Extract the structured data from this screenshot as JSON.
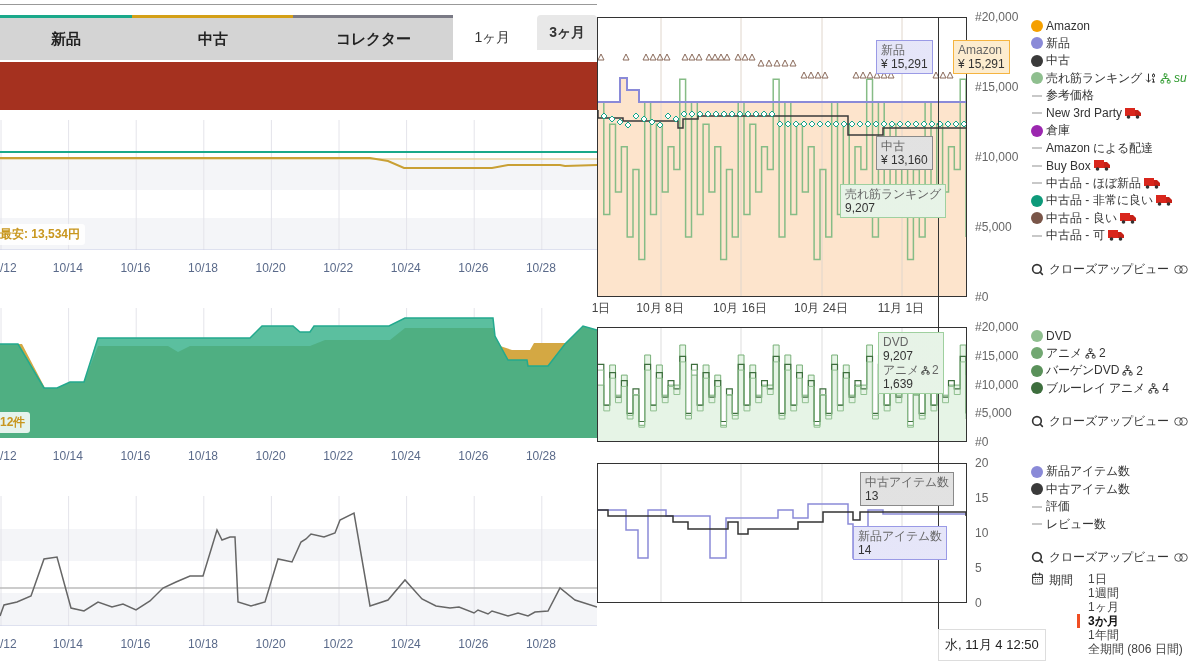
{
  "product_panel": {
    "condition_tabs": [
      {
        "label": "新品",
        "color": "#1aa88a"
      },
      {
        "label": "中古",
        "color": "#d4a017"
      },
      {
        "label": "コレクター",
        "color": "#7a7a85"
      }
    ],
    "range_tabs": [
      {
        "label": "1ヶ月",
        "selected": true
      },
      {
        "label": "3ヶ月",
        "selected": false
      }
    ],
    "charts": [
      {
        "kind": "price",
        "badge": "最安: 13,534円",
        "x_labels": [
          "/12",
          "10/14",
          "10/16",
          "10/18",
          "10/20",
          "10/22",
          "10/24",
          "10/26",
          "10/28"
        ]
      },
      {
        "kind": "offers",
        "badge": "12件",
        "x_labels": [
          "/12",
          "10/14",
          "10/16",
          "10/18",
          "10/20",
          "10/22",
          "10/24",
          "10/26",
          "10/28"
        ]
      },
      {
        "kind": "rank",
        "x_labels": [
          "/12",
          "10/14",
          "10/16",
          "10/18",
          "10/20",
          "10/22",
          "10/24",
          "10/26",
          "10/28"
        ]
      }
    ]
  },
  "history": {
    "sections": [
      {
        "kind": "price",
        "y_ticks": [
          "#20,000",
          "#15,000",
          "#10,000",
          "#5,000",
          "#0"
        ],
        "x_labels": [
          "1日",
          "10月 8日",
          "10月 16日",
          "10月 24日",
          "11月 1日"
        ],
        "tooltips": [
          {
            "color": "#9a9ae6",
            "rows": [
              {
                "label": "新品",
                "value": "¥ 15,291"
              }
            ]
          },
          {
            "color": "#f5b440",
            "rows": [
              {
                "label": "Amazon",
                "value": "¥ 15,291"
              }
            ]
          },
          {
            "color": "#8a8a8a",
            "rows": [
              {
                "label": "中古",
                "value": "¥ 13,160"
              }
            ]
          },
          {
            "color": "#9fd09f",
            "rows": [
              {
                "label": "売れ筋ランキング",
                "value": "9,207"
              }
            ]
          }
        ],
        "legend": [
          {
            "label": "Amazon",
            "kind": "dot",
            "color": "#f5a000",
            "truck": false
          },
          {
            "label": "新品",
            "kind": "dot",
            "color": "#8a8ad8",
            "truck": false
          },
          {
            "label": "中古",
            "kind": "dot",
            "color": "#3a3a3a",
            "truck": false
          },
          {
            "label": "売れ筋ランキング",
            "kind": "dot",
            "color": "#8fbf8f",
            "truck": false,
            "sortable": true,
            "category": "su"
          },
          {
            "label": "参考価格",
            "kind": "dash",
            "truck": false
          },
          {
            "label": "New 3rd Party",
            "kind": "dash",
            "truck": true
          },
          {
            "label": "倉庫",
            "kind": "dot",
            "color": "#9b27af",
            "truck": false
          },
          {
            "label": "Amazon による配達",
            "kind": "dash",
            "truck": false
          },
          {
            "label": "Buy Box",
            "kind": "dash",
            "truck": true
          },
          {
            "label": "中古品 - ほぼ新品",
            "kind": "dash",
            "truck": true
          },
          {
            "label": "中古品 - 非常に良い",
            "kind": "dot",
            "color": "#0e9a7a",
            "truck": true
          },
          {
            "label": "中古品 - 良い",
            "kind": "dot",
            "color": "#795548",
            "truck": true
          },
          {
            "label": "中古品 - 可",
            "kind": "dash",
            "truck": true
          }
        ],
        "closeup": "クローズアップビュー"
      },
      {
        "kind": "category",
        "y_ticks": [
          "#20,000",
          "#15,000",
          "#10,000",
          "#5,000",
          "#0"
        ],
        "tooltips": [
          {
            "color": "#9fd09f",
            "rows": [
              {
                "label": "DVD",
                "value": "9,207"
              },
              {
                "label": "アニメ",
                "count": "2",
                "value": "1,639"
              }
            ]
          }
        ],
        "legend": [
          {
            "label": "DVD",
            "kind": "dot",
            "color": "#8fbf8f",
            "truck": false
          },
          {
            "label": "アニメ",
            "kind": "dot",
            "color": "#72a872",
            "truck": false,
            "count": "2"
          },
          {
            "label": "バーゲンDVD",
            "kind": "dot",
            "color": "#5a915a",
            "truck": false,
            "count": "2"
          },
          {
            "label": "ブルーレイ アニメ",
            "kind": "dot",
            "color": "#3d6e3d",
            "truck": false,
            "count": "4"
          }
        ],
        "closeup": "クローズアップビュー"
      },
      {
        "kind": "count",
        "y_ticks": [
          "20",
          "15",
          "10",
          "5",
          "0"
        ],
        "tooltips": [
          {
            "color": "#8a8a8a",
            "rows": [
              {
                "label": "中古アイテム数",
                "value": "13"
              }
            ]
          },
          {
            "color": "#9a9ae6",
            "rows": [
              {
                "label": "新品アイテム数",
                "value": "14"
              }
            ]
          }
        ],
        "legend": [
          {
            "label": "新品アイテム数",
            "kind": "dot",
            "color": "#8a8ad8",
            "truck": false
          },
          {
            "label": "中古アイテム数",
            "kind": "dot",
            "color": "#3a3a3a",
            "truck": false
          },
          {
            "label": "評価",
            "kind": "dash",
            "truck": false
          },
          {
            "label": "レビュー数",
            "kind": "dash",
            "truck": false
          }
        ],
        "closeup": "クローズアップビュー",
        "period": {
          "label": "期間",
          "options": [
            {
              "label": "1日",
              "selected": false
            },
            {
              "label": "1週間",
              "selected": false
            },
            {
              "label": "1ヶ月",
              "selected": false
            },
            {
              "label": "3か月",
              "selected": true
            },
            {
              "label": "1年間",
              "selected": false
            },
            {
              "label": "全期間 (806 日間)",
              "selected": false
            }
          ]
        }
      }
    ],
    "cursor_time": "水, 11月 4 12:50"
  }
}
